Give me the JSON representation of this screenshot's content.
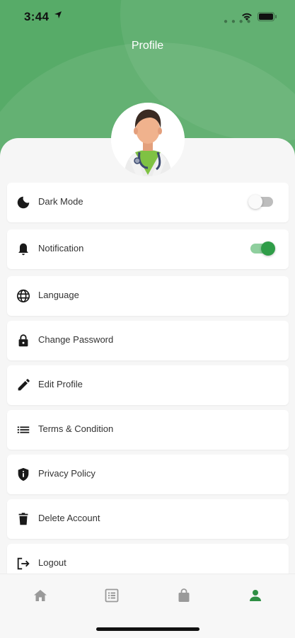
{
  "status_bar": {
    "time": "3:44"
  },
  "header": {
    "title": "Profile"
  },
  "avatar": {
    "icon": "doctor-avatar"
  },
  "menu": {
    "items": [
      {
        "label": "Dark Mode",
        "icon": "moon-icon",
        "toggle": "off"
      },
      {
        "label": "Notification",
        "icon": "bell-icon",
        "toggle": "on"
      },
      {
        "label": "Language",
        "icon": "globe-icon"
      },
      {
        "label": "Change Password",
        "icon": "lock-icon"
      },
      {
        "label": "Edit Profile",
        "icon": "pencil-icon"
      },
      {
        "label": "Terms & Condition",
        "icon": "list-icon"
      },
      {
        "label": "Privacy Policy",
        "icon": "shield-icon"
      },
      {
        "label": "Delete Account",
        "icon": "trash-icon"
      },
      {
        "label": "Logout",
        "icon": "logout-icon"
      }
    ]
  },
  "tabbar": {
    "tabs": [
      {
        "icon": "home-icon",
        "active": false
      },
      {
        "icon": "list-box-icon",
        "active": false
      },
      {
        "icon": "shopping-bag-icon",
        "active": false
      },
      {
        "icon": "person-icon",
        "active": true
      }
    ]
  },
  "colors": {
    "primary": "#57ab68",
    "accent": "#2f9d48",
    "active_tab": "#2f8f44",
    "inactive_tab": "#9a9a9a"
  }
}
